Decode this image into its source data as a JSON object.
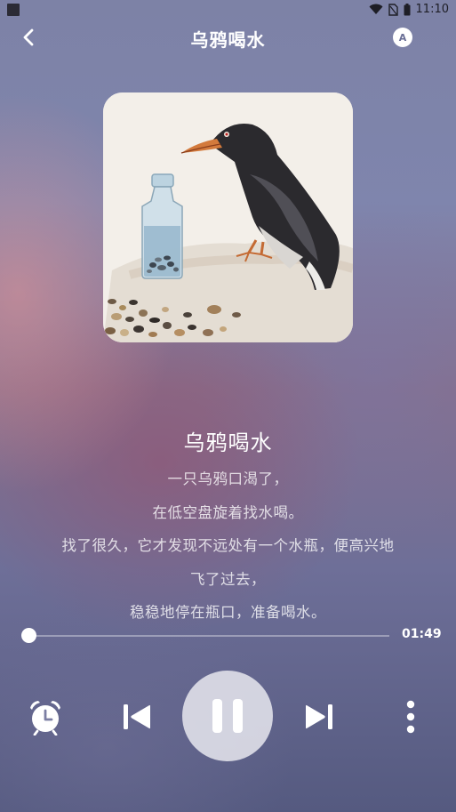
{
  "status_bar": {
    "time": "11:10"
  },
  "header": {
    "title": "乌鸦喝水",
    "auto_label": "A"
  },
  "cover": {
    "alt": "crow and bottle painting"
  },
  "story": {
    "title": "乌鸦喝水",
    "lines": [
      "一只乌鸦口渴了，",
      "在低空盘旋着找水喝。",
      "找了很久，它才发现不远处有一个水瓶，便高兴地",
      "飞了过去，",
      "稳稳地停在瓶口，准备喝水。"
    ]
  },
  "player": {
    "total_time": "01:49",
    "progress": 0.0
  },
  "icons": {
    "back": "back-icon",
    "auto": "auto-icon",
    "alarm": "alarm-clock-icon",
    "prev": "skip-previous-icon",
    "pause": "pause-icon",
    "next": "skip-next-icon",
    "more": "more-vertical-icon"
  }
}
